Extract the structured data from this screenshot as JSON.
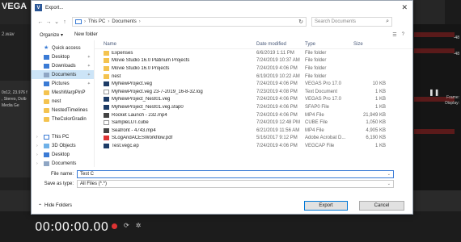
{
  "background_app": {
    "title": "VEGA",
    "wav_label": "2.wav",
    "left_panel_lines": [
      "0x12, 23.976 f",
      ", Stereo, Dolb",
      "Media Ge"
    ],
    "right_numbers": [
      "-48",
      "-48"
    ],
    "right_labels": [
      "Frame:",
      "Display:"
    ],
    "timecode": "00:00:00.00"
  },
  "dialog": {
    "title": "Export...",
    "address": {
      "segments": [
        "This PC",
        "Documents"
      ]
    },
    "search_placeholder": "Search Documents",
    "toolbar": {
      "organize": "Organize ▾",
      "new_folder": "New folder"
    },
    "nav": [
      {
        "label": "Quick access",
        "icon": "star",
        "chev": "",
        "pin": false,
        "selected": false
      },
      {
        "label": "Desktop",
        "icon": "blue",
        "chev": "",
        "pin": true,
        "selected": false
      },
      {
        "label": "Downloads",
        "icon": "blue",
        "chev": "",
        "pin": true,
        "selected": false
      },
      {
        "label": "Documents",
        "icon": "doc",
        "chev": "",
        "pin": true,
        "selected": true
      },
      {
        "label": "Pictures",
        "icon": "blue",
        "chev": "",
        "pin": true,
        "selected": false
      },
      {
        "label": "MeshWarpPinP",
        "icon": "folder",
        "chev": "",
        "pin": false,
        "selected": false
      },
      {
        "label": "nest",
        "icon": "folder",
        "chev": "",
        "pin": false,
        "selected": false
      },
      {
        "label": "NestedTimelines",
        "icon": "folder",
        "chev": "",
        "pin": false,
        "selected": false
      },
      {
        "label": "TheColorGradin",
        "icon": "folder",
        "chev": "",
        "pin": false,
        "selected": false
      },
      {
        "label": "",
        "icon": "",
        "chev": "",
        "pin": false,
        "selected": false
      },
      {
        "label": "This PC",
        "icon": "pc",
        "chev": "›",
        "pin": false,
        "selected": false
      },
      {
        "label": "3D Objects",
        "icon": "cube",
        "chev": "›",
        "pin": false,
        "selected": false
      },
      {
        "label": "Desktop",
        "icon": "blue",
        "chev": "›",
        "pin": false,
        "selected": false
      },
      {
        "label": "Documents",
        "icon": "doc",
        "chev": "›",
        "pin": false,
        "selected": false
      }
    ],
    "columns": {
      "name": "Name",
      "date": "Date modified",
      "type": "Type",
      "size": "Size"
    },
    "files": [
      {
        "name": "Expenses",
        "date": "6/6/2019 1:11 PM",
        "type": "File folder",
        "size": "",
        "icon": "folder"
      },
      {
        "name": "Movie Studio 16.0 Platinum Projects",
        "date": "7/24/2019 10:37 AM",
        "type": "File folder",
        "size": "",
        "icon": "folder"
      },
      {
        "name": "Movie Studio 16.0 Projects",
        "date": "7/24/2019 4:06 PM",
        "type": "File folder",
        "size": "",
        "icon": "folder"
      },
      {
        "name": "nest",
        "date": "6/19/2019 10:22 AM",
        "type": "File folder",
        "size": "",
        "icon": "folder"
      },
      {
        "name": "MyNewProject.veg",
        "date": "7/24/2019 4:06 PM",
        "type": "VEGAS Pro 17.0",
        "size": "10 KB",
        "icon": "veg"
      },
      {
        "name": "MyNewProject.veg 23-7-2019_16-8-32.log",
        "date": "7/23/2019 4:08 PM",
        "type": "Text Document",
        "size": "1 KB",
        "icon": "file"
      },
      {
        "name": "MyNewProject_Nest01.veg",
        "date": "7/24/2019 4:06 PM",
        "type": "VEGAS Pro 17.0",
        "size": "1 KB",
        "icon": "veg"
      },
      {
        "name": "MyNewProject_Nest01.veg.sfap0",
        "date": "7/24/2019 4:06 PM",
        "type": "SFAP0 File",
        "size": "1 KB",
        "icon": "veg"
      },
      {
        "name": "Rocket Launch - 232.mp4",
        "date": "7/24/2019 4:06 PM",
        "type": "MP4 File",
        "size": "21,949 KB",
        "icon": "mp4"
      },
      {
        "name": "SampleLUT.cube",
        "date": "7/24/2019 12:48 PM",
        "type": "CUBE File",
        "size": "1,050 KB",
        "icon": "file"
      },
      {
        "name": "Seafront - 4743.mp4",
        "date": "6/21/2019 11:56 AM",
        "type": "MP4 File",
        "size": "4,905 KB",
        "icon": "mp4"
      },
      {
        "name": "SLogAndACESWorkflow.pdf",
        "date": "5/16/2017 9:12 PM",
        "type": "Adobe Acrobat D...",
        "size": "6,190 KB",
        "icon": "pdf"
      },
      {
        "name": "Test.vegc.ep",
        "date": "7/24/2019 4:06 PM",
        "type": "VEGCAP File",
        "size": "1 KB",
        "icon": "veg"
      }
    ],
    "filename_label": "File name:",
    "filename_value": "Test C",
    "saveas_label": "Save as type:",
    "saveas_value": "All Files (*.*)",
    "hide_folders": "Hide Folders",
    "export_button": "Export",
    "cancel_button": "Cancel"
  }
}
